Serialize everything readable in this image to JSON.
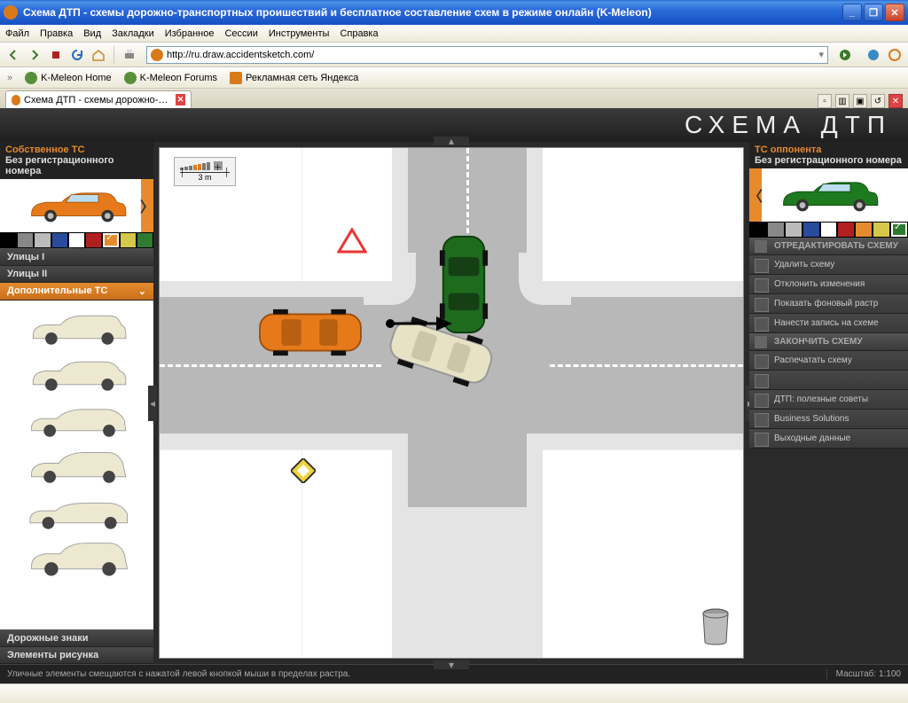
{
  "window": {
    "title": "Схема ДТП - схемы дорожно-транспортных проишествий и бесплатное составление схем в режиме онлайн (K-Meleon)"
  },
  "menu": {
    "items": [
      "Файл",
      "Правка",
      "Вид",
      "Закладки",
      "Избранное",
      "Сессии",
      "Инструменты",
      "Справка"
    ]
  },
  "address": {
    "url": "http://ru.draw.accidentsketch.com/"
  },
  "bookmarks": {
    "items": [
      "K-Meleon Home",
      "K-Meleon Forums",
      "Рекламная сеть Яндекса"
    ]
  },
  "tab": {
    "label": "Схема ДТП - схемы дорожно-трансп..."
  },
  "app": {
    "logo": "СХЕМА ДТП",
    "left": {
      "title1": "Собственное ТС",
      "title2": "Без регистрационного номера",
      "colors": [
        "#000",
        "#888",
        "#bbb",
        "#2a4a9c",
        "#fff",
        "#b02020",
        "#e68a2e",
        "#d4c84a",
        "#2e7a2e"
      ],
      "selected_color_index": 6,
      "accordion": {
        "a": "Улицы I",
        "b": "Улицы II",
        "c": "Дополнительные ТС",
        "d": "Дорожные знаки",
        "e": "Элементы рисунка"
      }
    },
    "right": {
      "title1": "ТС оппонента",
      "title2": "Без регистрационного номера",
      "colors": [
        "#000",
        "#888",
        "#bbb",
        "#2a4a9c",
        "#fff",
        "#b02020",
        "#e68a2e",
        "#d4c84a",
        "#2e7a2e"
      ],
      "selected_color_index": 8,
      "menu": {
        "hdr1": "ОТРЕДАКТИРОВАТЬ СХЕМУ",
        "r1": "Удалить схему",
        "r2": "Отклонить изменения",
        "r3": "Показать фоновый растр",
        "r4": "Нанести запись на схеме",
        "hdr2": "ЗАКОНЧИТЬ СХЕМУ",
        "r5": "Распечатать схему",
        "r6": "",
        "r7": "ДТП: полезные советы",
        "r8": "Business Solutions",
        "r9": "Выходные данные"
      }
    },
    "scale_label": "3 m",
    "status_left": "Уличные элементы смещаются с нажатой левой кнопкой мыши в пределах растра.",
    "status_right": "Масштаб: 1:100"
  }
}
